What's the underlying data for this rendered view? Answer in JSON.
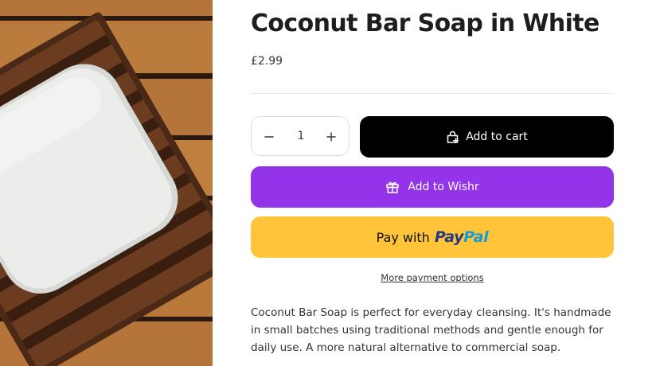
{
  "product": {
    "title": "Coconut Bar Soap in White",
    "price": "£2.99",
    "image_alt": "Coconut Bar Soap in White",
    "description": "Coconut Bar Soap is perfect for everyday cleansing. It's handmade in small batches using traditional methods and gentle enough for daily use. A more natural alternative to commercial soap."
  },
  "quantity": {
    "value": "1",
    "decrease_icon": "minus-icon",
    "increase_icon": "plus-icon"
  },
  "buttons": {
    "add_to_cart": "Add to cart",
    "add_to_cart_icon": "cart-add-icon",
    "add_to_wishr": "Add to Wishr",
    "add_to_wishr_icon": "gift-icon",
    "paypal_prefix": "Pay with",
    "paypal_logo_pay": "Pay",
    "paypal_logo_pal": "Pal",
    "more_payment_options": "More payment options"
  },
  "colors": {
    "cart_button": "#000000",
    "wishr_button": "#9333ea",
    "paypal_button": "#ffc439",
    "paypal_dark_blue": "#253b80",
    "paypal_light_blue": "#179bd7"
  }
}
